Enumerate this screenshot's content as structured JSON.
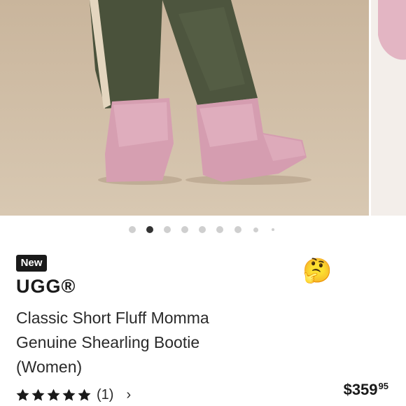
{
  "product": {
    "badge": "New",
    "brand": "UGG®",
    "title_lines": [
      "Classic Short Fluff Momma",
      "Genuine Shearling Bootie",
      "(Women)"
    ],
    "rating_value": 5,
    "rating_max": 5,
    "review_count": "(1)",
    "price_main": "$359",
    "price_cents": "95"
  },
  "gallery": {
    "current_index": 1,
    "total": 9,
    "dot_active_color": "#333333",
    "dot_inactive_color": "#cfcfcf"
  },
  "icons": {
    "thinking": "thinking-face-emoji",
    "star": "star-icon",
    "chevron": "chevron-right-icon"
  },
  "glyphs": {
    "thinking": "🤔",
    "chevron": "›"
  },
  "colors": {
    "background": "#ffffff",
    "badge_bg": "#1a1a1a",
    "text": "#1a1a1a",
    "photo_bg": "#cdb9a0",
    "boot_pink": "#d9a0b0"
  }
}
